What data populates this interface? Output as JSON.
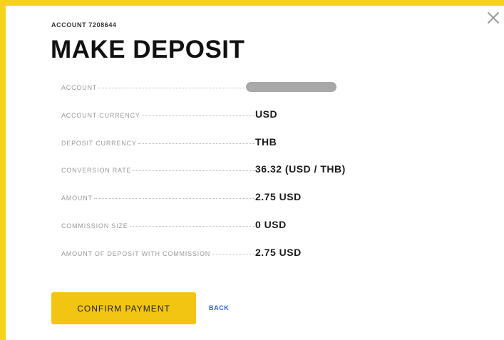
{
  "account_label": "ACCOUNT 7208644",
  "title": "MAKE DEPOSIT",
  "details": [
    {
      "label": "ACCOUNT",
      "value": "",
      "masked": true
    },
    {
      "label": "ACCOUNT CURRENCY",
      "value": "USD"
    },
    {
      "label": "DEPOSIT CURRENCY",
      "value": "THB"
    },
    {
      "label": "CONVERSION RATE",
      "value": "36.32 (USD / THB)"
    },
    {
      "label": "AMOUNT",
      "value": "2.75 USD"
    },
    {
      "label": "COMMISSION SIZE",
      "value": "0 USD"
    },
    {
      "label": "AMOUNT OF DEPOSIT WITH COMMISSION",
      "value": "2.75 USD"
    }
  ],
  "actions": {
    "confirm_label": "CONFIRM PAYMENT",
    "back_label": "BACK"
  },
  "icons": {
    "close": "close-icon",
    "masked_value": "redacted-bar"
  },
  "colors": {
    "accent": "#f2c512",
    "frame": "#f7d21a",
    "link": "#2f63c8"
  }
}
